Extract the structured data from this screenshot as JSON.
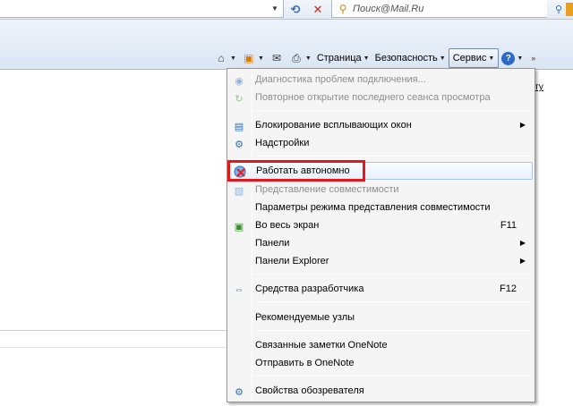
{
  "topbar": {
    "search_placeholder": "Поиск@Mail.Ru",
    "refresh_icon": "refresh-icon",
    "stop_icon": "stop-icon"
  },
  "command_bar": {
    "page_label": "Страница",
    "safety_label": "Безопасность",
    "tools_label": "Сервис",
    "icons": [
      "home-icon",
      "feeds-icon",
      "mail-icon",
      "print-icon",
      "help-icon"
    ]
  },
  "page": {
    "link_fragment": "чту"
  },
  "tools_menu": {
    "items": [
      {
        "label": "Диагностика проблем подключения...",
        "icon": "diagnose-icon",
        "disabled": true
      },
      {
        "label": "Повторное открытие последнего сеанса просмотра",
        "icon": "reopen-session-icon",
        "disabled": true
      },
      {
        "label": "Блокирование всплывающих окон",
        "icon": "popup-blocker-icon",
        "submenu": true
      },
      {
        "label": "Надстройки",
        "icon": "addons-icon"
      },
      {
        "label": "Работать автономно",
        "icon": "work-offline-icon",
        "highlighted": true
      },
      {
        "label": "Представление совместимости",
        "icon": "compat-view-icon",
        "disabled": true
      },
      {
        "label": "Параметры режима представления совместимости"
      },
      {
        "label": "Во весь экран",
        "icon": "fullscreen-icon",
        "shortcut": "F11"
      },
      {
        "label": "Панели",
        "submenu": true
      },
      {
        "label": "Панели Explorer",
        "submenu": true
      },
      {
        "label": "Средства разработчика",
        "icon": "dev-tools-icon",
        "shortcut": "F12"
      },
      {
        "label": "Рекомендуемые узлы"
      },
      {
        "label": "Связанные заметки OneNote"
      },
      {
        "label": "Отправить в OneNote"
      },
      {
        "label": "Свойства обозревателя",
        "icon": "internet-options-icon"
      }
    ]
  },
  "colors": {
    "highlight_border": "#e3181d",
    "disabled_text": "#8d8d8d",
    "menu_bg": "#f5f5f5"
  }
}
